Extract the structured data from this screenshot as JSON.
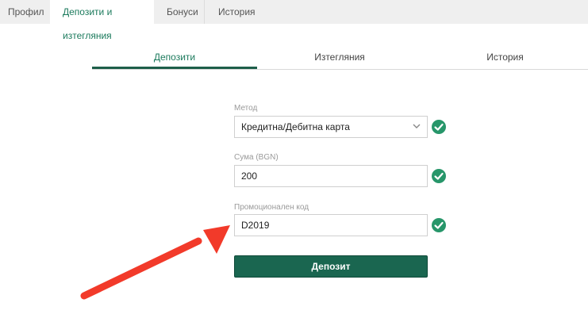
{
  "top_tabs": [
    {
      "label": "Профил"
    },
    {
      "label": "Депозити и изтегляния"
    },
    {
      "label": "Бонуси"
    },
    {
      "label": "История"
    }
  ],
  "sub_tabs": [
    {
      "label": "Депозити"
    },
    {
      "label": "Изтегляния"
    },
    {
      "label": "История"
    }
  ],
  "form": {
    "method_label": "Метод",
    "method_value": "Кредитна/Дебитна карта",
    "amount_label": "Сума (BGN)",
    "amount_value": "200",
    "promo_label": "Промоционален код",
    "promo_value": "D2019",
    "submit_label": "Депозит"
  },
  "colors": {
    "accent": "#1b7a5c",
    "button": "#1a6650",
    "check": "#27966a",
    "annotation_arrow": "#f23a2a"
  },
  "icons": {
    "select_chevron": "chevron-down-icon",
    "valid": "check-circle-icon",
    "annotation": "red-arrow-icon"
  }
}
